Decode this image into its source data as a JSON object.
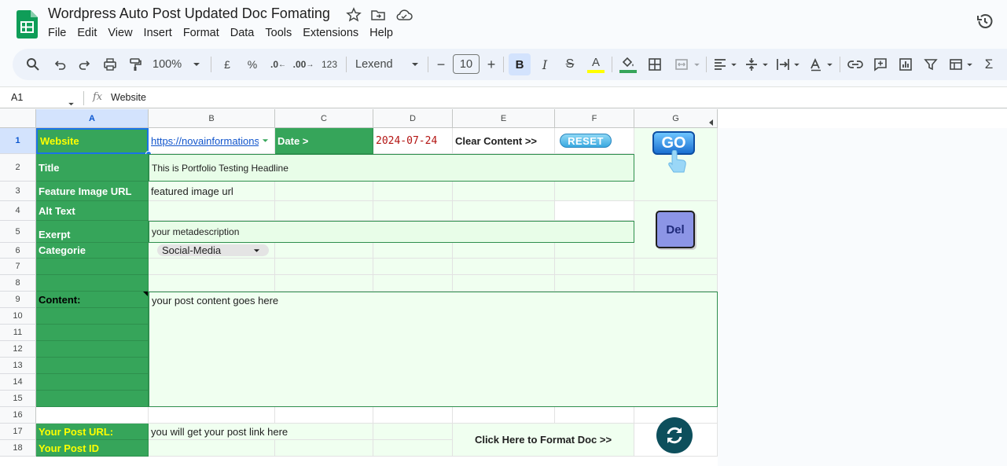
{
  "header": {
    "title": "Wordpress Auto Post Updated Doc Fomating",
    "menu": [
      "File",
      "Edit",
      "View",
      "Insert",
      "Format",
      "Data",
      "Tools",
      "Extensions",
      "Help"
    ]
  },
  "toolbar": {
    "zoom": "100%",
    "currency": "£",
    "percent": "%",
    "dec_decrease": ".0",
    "dec_increase": ".00",
    "number_format": "123",
    "font": "Lexend",
    "font_size": "10",
    "minus": "−",
    "plus": "+",
    "bold": "B",
    "italic": "I",
    "strike": "S",
    "text_color": "A",
    "sigma": "Σ"
  },
  "formula_bar": {
    "cell_ref": "A1",
    "fx": "fx",
    "value": "Website"
  },
  "columns": [
    "A",
    "B",
    "C",
    "D",
    "E",
    "F",
    "G"
  ],
  "rows": [
    "1",
    "2",
    "3",
    "4",
    "5",
    "6",
    "7",
    "8",
    "9",
    "10",
    "11",
    "12",
    "13",
    "14",
    "15",
    "16",
    "17",
    "18"
  ],
  "cells": {
    "a1": "Website",
    "b1": "https://novainformations",
    "c1": "Date >",
    "d1": "2024-07-24",
    "e1": "Clear Content >>",
    "f1": "RESET",
    "a2": "Title",
    "b2": "This is Portfolio Testing Headline",
    "a3": "Feature Image URL",
    "b3": "featured image url",
    "a4": "Alt Text",
    "a5": "Exerpt",
    "b5": "your metadescription",
    "a6": "Categorie",
    "b6": "Social-Media",
    "a9": "Content:",
    "b9": "your post content goes here",
    "a17": "Your Post URL:",
    "b17": "you will get your post link here",
    "a18": "Your Post ID",
    "e17": "Click Here to Format Doc >>",
    "go": "GO",
    "del": "Del"
  },
  "colors": {
    "green": "#36a55a",
    "light_green": "#f0fff0",
    "yellow_text": "#ffff00",
    "date_red": "#b31412",
    "toolbar_bg": "#edf2fa"
  }
}
